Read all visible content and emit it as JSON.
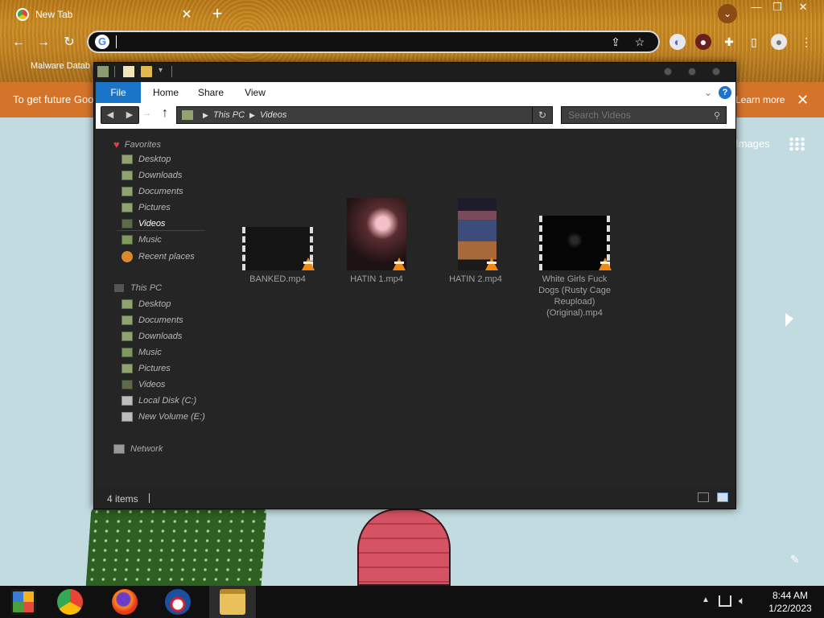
{
  "browser": {
    "tab_title": "New Tab",
    "tab_close": "✕",
    "new_tab": "+",
    "url_value": "",
    "bookmark": "Malware Datab",
    "info_bar_text": "To get future Goo",
    "info_bar_link": "Learn more",
    "info_bar_close": "✕",
    "ntp_images": "Images",
    "window_controls": {
      "minimize": "—",
      "maximize": "❐",
      "close": "✕"
    }
  },
  "explorer": {
    "ribbon_tabs": [
      "File",
      "Home",
      "Share",
      "View"
    ],
    "breadcrumb": [
      "This PC",
      "Videos"
    ],
    "search_placeholder": "Search Videos",
    "nav": {
      "favorites_header": "Favorites",
      "favorites": [
        "Desktop",
        "Downloads",
        "Documents",
        "Pictures",
        "Videos",
        "Music",
        "Recent places"
      ],
      "thispc_header": "This PC",
      "thispc": [
        "Desktop",
        "Documents",
        "Downloads",
        "Music",
        "Pictures",
        "Videos",
        "Local Disk (C:)",
        "New Volume (E:)"
      ],
      "network": "Network"
    },
    "files": [
      {
        "name": "BANKED.mp4"
      },
      {
        "name": "HATIN 1.mp4"
      },
      {
        "name": "HATIN 2.mp4"
      },
      {
        "name": "White Girls Fuck Dogs (Rusty Cage Reupload) (Original).mp4"
      }
    ],
    "status_count": "4 items"
  },
  "taskbar": {
    "time": "8:44 AM",
    "date": "1/22/2023"
  },
  "colors": {
    "ribbon_file_tab": "#1a75c9",
    "info_bar": "#d4742a",
    "explorer_bg": "#232323",
    "taskbar": "#101010"
  }
}
